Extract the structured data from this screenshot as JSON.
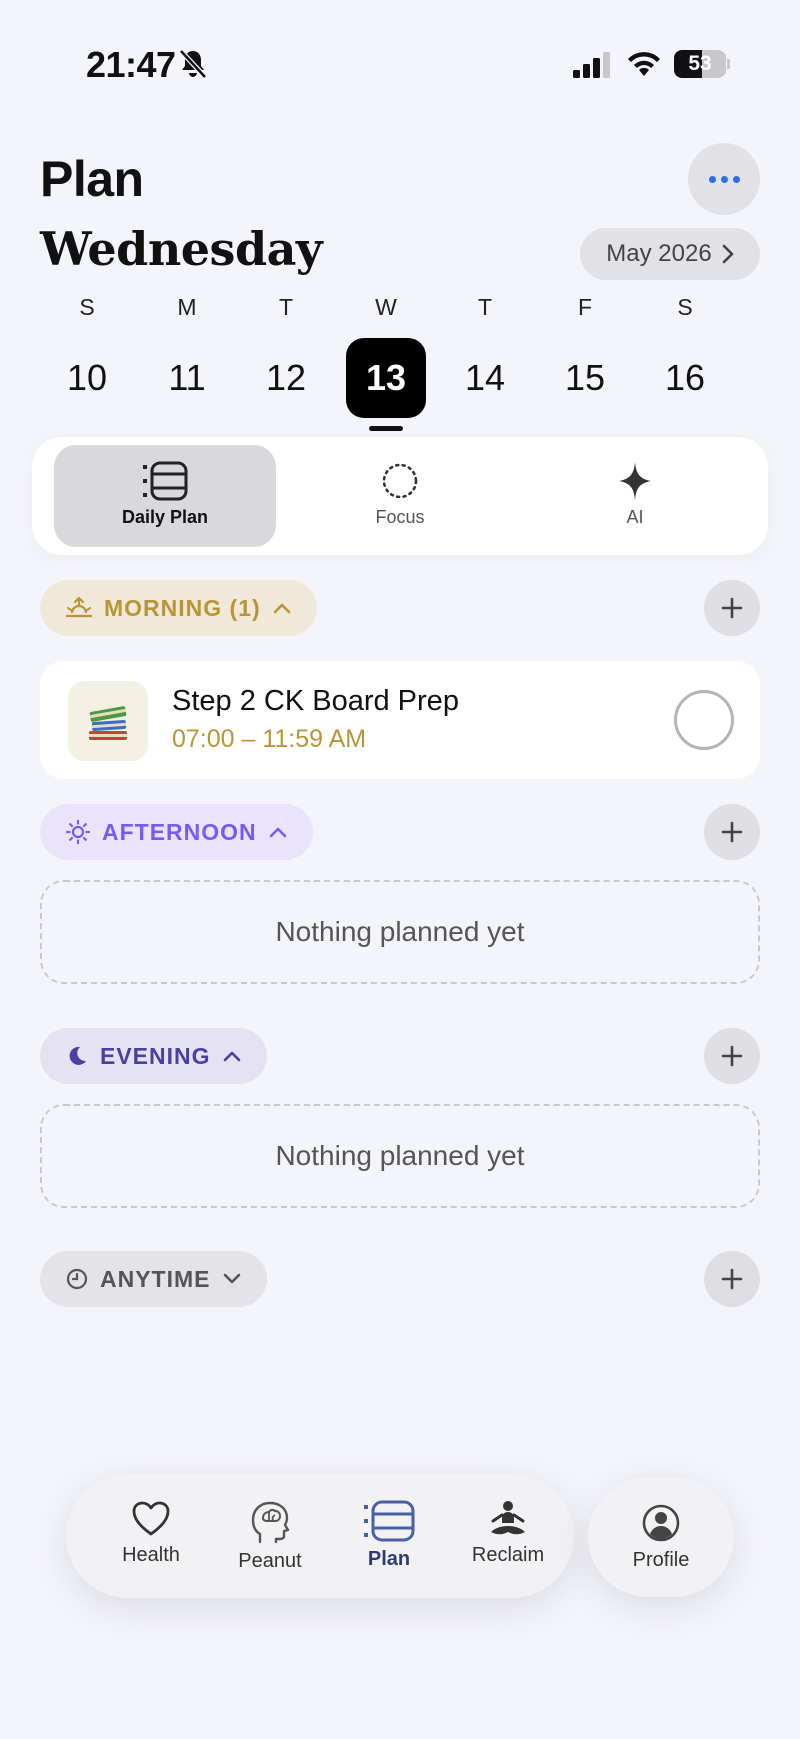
{
  "status_bar": {
    "time": "21:47",
    "battery": "53",
    "battery_level_percent": 53
  },
  "header": {
    "title": "Plan",
    "day_name": "Wednesday",
    "month_label": "May 2026"
  },
  "week": [
    {
      "letter": "S",
      "date": "10"
    },
    {
      "letter": "M",
      "date": "11"
    },
    {
      "letter": "T",
      "date": "12"
    },
    {
      "letter": "W",
      "date": "13",
      "selected": true
    },
    {
      "letter": "T",
      "date": "14"
    },
    {
      "letter": "F",
      "date": "15"
    },
    {
      "letter": "S",
      "date": "16"
    }
  ],
  "segments": [
    {
      "label": "Daily Plan",
      "icon": "list-icon",
      "active": true
    },
    {
      "label": "Focus",
      "icon": "dotted-circle-icon"
    },
    {
      "label": "AI",
      "icon": "sparkle-icon"
    }
  ],
  "sections": {
    "morning": {
      "label": "MORNING (1)",
      "color": "#b99536",
      "bg": "#f0e9d9",
      "task": {
        "title": "Step 2 CK Board Prep",
        "time": "07:00 – 11:59 AM",
        "icon": "books-icon"
      }
    },
    "afternoon": {
      "label": "AFTERNOON",
      "color": "#7a5af5",
      "bg": "#e9e4fb",
      "empty": "Nothing planned yet"
    },
    "evening": {
      "label": "EVENING",
      "color": "#4a3fa3",
      "bg": "#e4e2f3",
      "empty": "Nothing planned yet"
    },
    "anytime": {
      "label": "ANYTIME",
      "color": "#555555",
      "bg": "#e4e4e8"
    }
  },
  "tabbar": {
    "tabs": [
      {
        "label": "Health",
        "icon": "heart-icon"
      },
      {
        "label": "Peanut",
        "icon": "brain-head-icon"
      },
      {
        "label": "Plan",
        "icon": "list-icon",
        "active": true
      },
      {
        "label": "Reclaim",
        "icon": "meditation-icon"
      }
    ],
    "profile": {
      "label": "Profile",
      "icon": "person-circle-icon"
    }
  }
}
